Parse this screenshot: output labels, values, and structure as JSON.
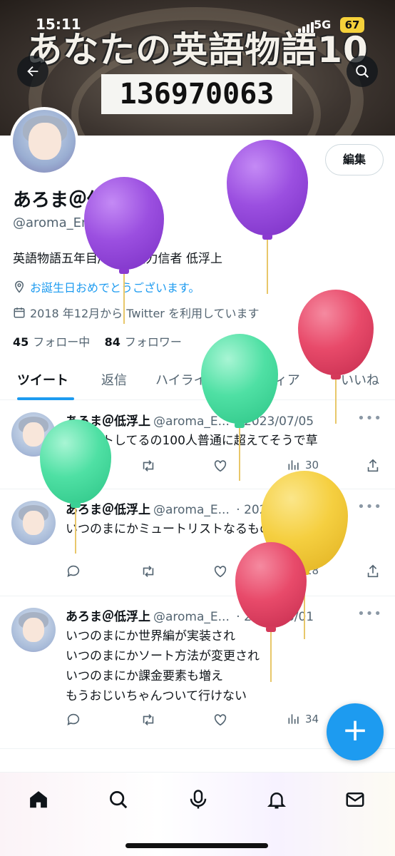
{
  "status": {
    "time": "15:11",
    "network": "5G",
    "battery": "67"
  },
  "banner": {
    "title": "あなたの英語物語10",
    "number": "136970063"
  },
  "profile": {
    "edit_label": "編集",
    "name": "あろま＠低浮上",
    "handle": "@aroma_English",
    "bio": "英語物語五年目/6ステ協力信者 低浮上",
    "location_link": "お誕生日おめでとうございます。",
    "joined": "2018 年12月から Twitter を利用しています",
    "following_count": "45",
    "following_label": "フォロー中",
    "followers_count": "84",
    "followers_label": "フォロワー"
  },
  "tabs": [
    "ツイート",
    "返信",
    "ハイライト",
    "メディア",
    "いいね"
  ],
  "tweets": [
    {
      "name": "あろま＠低浮上",
      "handle": "@aroma_E...",
      "date": "· 2023/07/05",
      "text": "ミュートしてるの100人普通に超えてそうで草",
      "views": "30"
    },
    {
      "name": "あろま＠低浮上",
      "handle": "@aroma_E...",
      "date": "· 2023/07/05",
      "text": "いつのまにかミュートリストなるものできてて感動",
      "views": "28"
    },
    {
      "name": "あろま＠低浮上",
      "handle": "@aroma_E...",
      "date": "· 2023/06/01",
      "text": "いつのまにか世界編が実装され\nいつのまにかソート方法が変更され\nいつのまにか課金要素も増え\nもうおじいちゃんついて行けない",
      "views": "34"
    }
  ],
  "fab_label": "+",
  "nav": [
    "home-icon",
    "search-icon",
    "spaces-icon",
    "notifications-icon",
    "messages-icon"
  ],
  "colors": {
    "accent": "#1d9bf0",
    "purple_balloon": "#9b4fe0",
    "green_balloon": "#4fe0a4",
    "red_balloon": "#e84a6a",
    "yellow_balloon": "#f5cf40"
  }
}
